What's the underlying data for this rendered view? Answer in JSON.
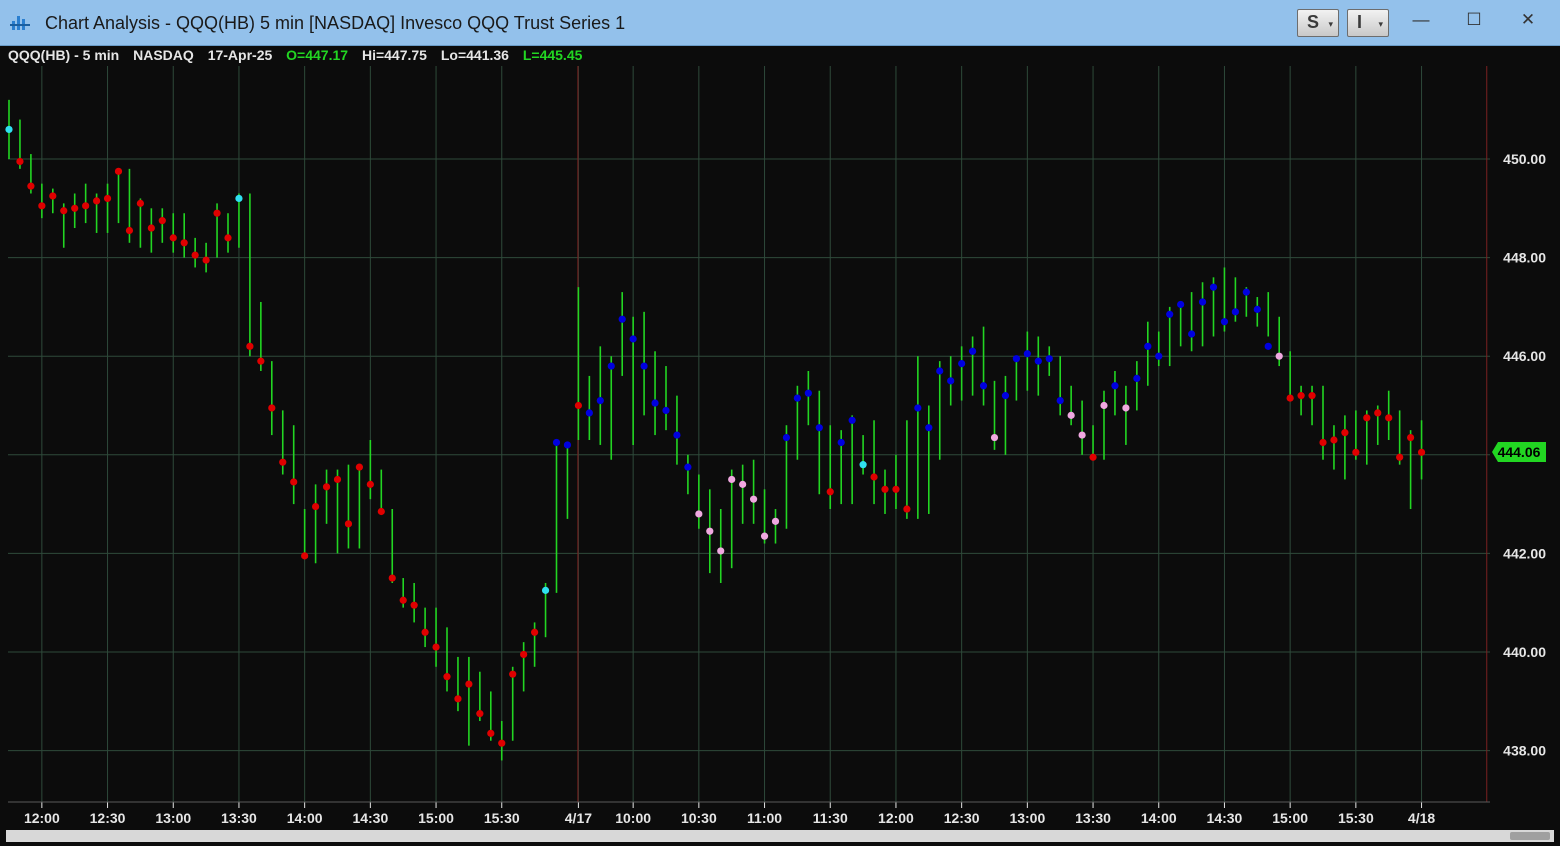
{
  "window": {
    "title": "Chart Analysis - QQQ(HB) 5 min [NASDAQ] Invesco QQQ Trust Series 1",
    "btn_s": "S",
    "btn_i": "I",
    "minimize": "—",
    "maximize": "☐",
    "close": "✕"
  },
  "header": {
    "symbol": "QQQ(HB) - 5 min",
    "exchange": "NASDAQ",
    "date": "17-Apr-25",
    "open": "O=447.17",
    "high": "Hi=447.75",
    "low": "Lo=441.36",
    "last": "L=445.45"
  },
  "last_price_label": "444.06",
  "colors": {
    "bar": "#22d622",
    "dot_red": "#e00000",
    "dot_blue": "#0000e0",
    "dot_pink": "#f0a8e0",
    "dot_cyan": "#30e0f0",
    "grid": "#2e4a3a",
    "session_line": "#7a2020",
    "text": "#e6e6e6",
    "last_price": "#22d622"
  },
  "chart_data": {
    "type": "ohlc-bar",
    "ylim": [
      437,
      452.3
    ],
    "y_ticks": [
      "450.00",
      "448.00",
      "446.00",
      "444.00",
      "442.00",
      "440.00",
      "438.00"
    ],
    "y_tick_values": [
      450,
      448,
      446,
      444,
      442,
      440,
      438
    ],
    "x_tick_labels": [
      "12:00",
      "12:30",
      "13:00",
      "13:30",
      "14:00",
      "14:30",
      "15:00",
      "15:30",
      "4/17",
      "10:00",
      "10:30",
      "11:00",
      "11:30",
      "12:00",
      "12:30",
      "13:00",
      "13:30",
      "14:00",
      "14:30",
      "15:00",
      "15:30",
      "4/18"
    ],
    "x_tick_bar_index": [
      3,
      9,
      15,
      21,
      27,
      33,
      39,
      45,
      52,
      57,
      63,
      69,
      75,
      81,
      87,
      93,
      99,
      105,
      111,
      117,
      123,
      129
    ],
    "session_break_bar_index": [
      52,
      135
    ],
    "dot_series_names": [
      "red",
      "blue",
      "pink",
      "cyan"
    ],
    "bars": [
      {
        "h": 451.2,
        "l": 450.0,
        "c": 450.6,
        "d": 3
      },
      {
        "h": 450.8,
        "l": 449.8,
        "c": 449.95,
        "d": 0
      },
      {
        "h": 450.1,
        "l": 449.3,
        "c": 449.45,
        "d": 0
      },
      {
        "h": 449.5,
        "l": 448.8,
        "c": 449.05,
        "d": 0
      },
      {
        "h": 449.4,
        "l": 448.9,
        "c": 449.25,
        "d": 0
      },
      {
        "h": 449.1,
        "l": 448.2,
        "c": 448.95,
        "d": 0
      },
      {
        "h": 449.3,
        "l": 448.6,
        "c": 449.0,
        "d": 0
      },
      {
        "h": 449.5,
        "l": 448.7,
        "c": 449.05,
        "d": 0
      },
      {
        "h": 449.3,
        "l": 448.5,
        "c": 449.15,
        "d": 0
      },
      {
        "h": 449.5,
        "l": 448.5,
        "c": 449.2,
        "d": 0
      },
      {
        "h": 449.8,
        "l": 448.7,
        "c": 449.75,
        "d": 0
      },
      {
        "h": 449.8,
        "l": 448.3,
        "c": 448.55,
        "d": 0
      },
      {
        "h": 449.2,
        "l": 448.2,
        "c": 449.1,
        "d": 0
      },
      {
        "h": 449.0,
        "l": 448.1,
        "c": 448.6,
        "d": 0
      },
      {
        "h": 449.0,
        "l": 448.3,
        "c": 448.75,
        "d": 0
      },
      {
        "h": 448.9,
        "l": 448.1,
        "c": 448.4,
        "d": 0
      },
      {
        "h": 448.9,
        "l": 448.0,
        "c": 448.3,
        "d": 0
      },
      {
        "h": 448.4,
        "l": 447.8,
        "c": 448.05,
        "d": 0
      },
      {
        "h": 448.3,
        "l": 447.7,
        "c": 447.95,
        "d": 0
      },
      {
        "h": 449.1,
        "l": 448.0,
        "c": 448.9,
        "d": 0
      },
      {
        "h": 448.9,
        "l": 448.1,
        "c": 448.4,
        "d": 0
      },
      {
        "h": 449.3,
        "l": 448.2,
        "c": 449.2,
        "d": 3
      },
      {
        "h": 449.3,
        "l": 446.0,
        "c": 446.2,
        "d": 0
      },
      {
        "h": 447.1,
        "l": 445.7,
        "c": 445.9,
        "d": 0
      },
      {
        "h": 445.9,
        "l": 444.4,
        "c": 444.95,
        "d": 0
      },
      {
        "h": 444.9,
        "l": 443.6,
        "c": 443.85,
        "d": 0
      },
      {
        "h": 444.6,
        "l": 443.0,
        "c": 443.45,
        "d": 0
      },
      {
        "h": 442.9,
        "l": 441.9,
        "c": 441.95,
        "d": 0
      },
      {
        "h": 443.4,
        "l": 441.8,
        "c": 442.95,
        "d": 0
      },
      {
        "h": 443.7,
        "l": 442.6,
        "c": 443.35,
        "d": 0
      },
      {
        "h": 443.7,
        "l": 442.0,
        "c": 443.5,
        "d": 0
      },
      {
        "h": 443.8,
        "l": 442.1,
        "c": 442.6,
        "d": 0
      },
      {
        "h": 443.8,
        "l": 442.1,
        "c": 443.75,
        "d": 0
      },
      {
        "h": 444.3,
        "l": 443.1,
        "c": 443.4,
        "d": 0
      },
      {
        "h": 443.7,
        "l": 442.8,
        "c": 442.85,
        "d": 0
      },
      {
        "h": 442.9,
        "l": 441.4,
        "c": 441.5,
        "d": 0
      },
      {
        "h": 441.5,
        "l": 440.9,
        "c": 441.05,
        "d": 0
      },
      {
        "h": 441.4,
        "l": 440.6,
        "c": 440.95,
        "d": 0
      },
      {
        "h": 440.9,
        "l": 440.1,
        "c": 440.4,
        "d": 0
      },
      {
        "h": 440.9,
        "l": 439.7,
        "c": 440.1,
        "d": 0
      },
      {
        "h": 440.5,
        "l": 439.2,
        "c": 439.5,
        "d": 0
      },
      {
        "h": 439.9,
        "l": 438.8,
        "c": 439.05,
        "d": 0
      },
      {
        "h": 439.9,
        "l": 438.1,
        "c": 439.35,
        "d": 0
      },
      {
        "h": 439.6,
        "l": 438.6,
        "c": 438.75,
        "d": 0
      },
      {
        "h": 439.2,
        "l": 438.2,
        "c": 438.35,
        "d": 0
      },
      {
        "h": 438.6,
        "l": 437.8,
        "c": 438.15,
        "d": 0
      },
      {
        "h": 439.7,
        "l": 438.2,
        "c": 439.55,
        "d": 0
      },
      {
        "h": 440.2,
        "l": 439.2,
        "c": 439.95,
        "d": 0
      },
      {
        "h": 440.6,
        "l": 439.7,
        "c": 440.4,
        "d": 0
      },
      {
        "h": 441.4,
        "l": 440.3,
        "c": 441.25,
        "d": 3
      },
      {
        "h": 444.3,
        "l": 441.2,
        "c": 444.25,
        "d": 1
      },
      {
        "h": 444.2,
        "l": 442.7,
        "c": 444.2,
        "d": 1
      },
      {
        "h": 447.4,
        "l": 444.3,
        "c": 445.0,
        "d": 0
      },
      {
        "h": 445.6,
        "l": 444.3,
        "c": 444.85,
        "d": 1
      },
      {
        "h": 446.2,
        "l": 444.2,
        "c": 445.1,
        "d": 1
      },
      {
        "h": 446.0,
        "l": 443.9,
        "c": 445.8,
        "d": 1
      },
      {
        "h": 447.3,
        "l": 445.6,
        "c": 446.75,
        "d": 1
      },
      {
        "h": 446.8,
        "l": 444.2,
        "c": 446.35,
        "d": 1
      },
      {
        "h": 446.9,
        "l": 444.8,
        "c": 445.8,
        "d": 1
      },
      {
        "h": 446.1,
        "l": 444.4,
        "c": 445.05,
        "d": 1
      },
      {
        "h": 445.8,
        "l": 444.5,
        "c": 444.9,
        "d": 1
      },
      {
        "h": 445.2,
        "l": 443.8,
        "c": 444.4,
        "d": 1
      },
      {
        "h": 444.0,
        "l": 443.2,
        "c": 443.75,
        "d": 1
      },
      {
        "h": 443.6,
        "l": 442.5,
        "c": 442.8,
        "d": 2
      },
      {
        "h": 443.3,
        "l": 441.6,
        "c": 442.45,
        "d": 2
      },
      {
        "h": 442.9,
        "l": 441.4,
        "c": 442.05,
        "d": 2
      },
      {
        "h": 443.7,
        "l": 441.7,
        "c": 443.5,
        "d": 2
      },
      {
        "h": 443.8,
        "l": 442.6,
        "c": 443.4,
        "d": 2
      },
      {
        "h": 443.9,
        "l": 442.6,
        "c": 443.1,
        "d": 2
      },
      {
        "h": 443.3,
        "l": 442.2,
        "c": 442.35,
        "d": 2
      },
      {
        "h": 442.9,
        "l": 442.2,
        "c": 442.65,
        "d": 2
      },
      {
        "h": 444.6,
        "l": 442.5,
        "c": 444.35,
        "d": 1
      },
      {
        "h": 445.4,
        "l": 443.9,
        "c": 445.15,
        "d": 1
      },
      {
        "h": 445.7,
        "l": 444.6,
        "c": 445.25,
        "d": 1
      },
      {
        "h": 445.3,
        "l": 443.2,
        "c": 444.55,
        "d": 1
      },
      {
        "h": 444.6,
        "l": 442.9,
        "c": 443.25,
        "d": 0
      },
      {
        "h": 444.5,
        "l": 443.0,
        "c": 444.25,
        "d": 1
      },
      {
        "h": 444.8,
        "l": 443.0,
        "c": 444.7,
        "d": 1
      },
      {
        "h": 444.4,
        "l": 443.6,
        "c": 443.8,
        "d": 3
      },
      {
        "h": 444.7,
        "l": 443.0,
        "c": 443.55,
        "d": 0
      },
      {
        "h": 443.7,
        "l": 442.8,
        "c": 443.3,
        "d": 0
      },
      {
        "h": 444.0,
        "l": 442.9,
        "c": 443.3,
        "d": 0
      },
      {
        "h": 444.7,
        "l": 442.7,
        "c": 442.9,
        "d": 0
      },
      {
        "h": 446.0,
        "l": 442.7,
        "c": 444.95,
        "d": 1
      },
      {
        "h": 445.0,
        "l": 442.8,
        "c": 444.55,
        "d": 1
      },
      {
        "h": 445.9,
        "l": 443.9,
        "c": 445.7,
        "d": 1
      },
      {
        "h": 446.0,
        "l": 445.0,
        "c": 445.5,
        "d": 1
      },
      {
        "h": 446.2,
        "l": 445.1,
        "c": 445.85,
        "d": 1
      },
      {
        "h": 446.4,
        "l": 445.2,
        "c": 446.1,
        "d": 1
      },
      {
        "h": 446.6,
        "l": 445.0,
        "c": 445.4,
        "d": 1
      },
      {
        "h": 445.5,
        "l": 444.1,
        "c": 444.35,
        "d": 2
      },
      {
        "h": 445.6,
        "l": 444.0,
        "c": 445.2,
        "d": 1
      },
      {
        "h": 446.0,
        "l": 445.1,
        "c": 445.95,
        "d": 1
      },
      {
        "h": 446.5,
        "l": 445.3,
        "c": 446.05,
        "d": 1
      },
      {
        "h": 446.4,
        "l": 445.2,
        "c": 445.9,
        "d": 1
      },
      {
        "h": 446.2,
        "l": 445.6,
        "c": 445.95,
        "d": 1
      },
      {
        "h": 446.0,
        "l": 444.8,
        "c": 445.1,
        "d": 1
      },
      {
        "h": 445.4,
        "l": 444.6,
        "c": 444.8,
        "d": 2
      },
      {
        "h": 445.1,
        "l": 444.0,
        "c": 444.4,
        "d": 2
      },
      {
        "h": 444.6,
        "l": 443.9,
        "c": 443.95,
        "d": 0
      },
      {
        "h": 445.3,
        "l": 443.9,
        "c": 445.0,
        "d": 2
      },
      {
        "h": 445.7,
        "l": 444.8,
        "c": 445.4,
        "d": 1
      },
      {
        "h": 445.4,
        "l": 444.2,
        "c": 444.95,
        "d": 2
      },
      {
        "h": 445.9,
        "l": 444.9,
        "c": 445.55,
        "d": 1
      },
      {
        "h": 446.7,
        "l": 445.4,
        "c": 446.2,
        "d": 1
      },
      {
        "h": 446.5,
        "l": 445.8,
        "c": 446.0,
        "d": 1
      },
      {
        "h": 447.0,
        "l": 445.8,
        "c": 446.85,
        "d": 1
      },
      {
        "h": 447.1,
        "l": 446.2,
        "c": 447.05,
        "d": 1
      },
      {
        "h": 447.3,
        "l": 446.1,
        "c": 446.45,
        "d": 1
      },
      {
        "h": 447.5,
        "l": 446.2,
        "c": 447.1,
        "d": 1
      },
      {
        "h": 447.6,
        "l": 446.4,
        "c": 447.4,
        "d": 1
      },
      {
        "h": 447.8,
        "l": 446.5,
        "c": 446.7,
        "d": 1
      },
      {
        "h": 447.6,
        "l": 446.7,
        "c": 446.9,
        "d": 1
      },
      {
        "h": 447.4,
        "l": 446.8,
        "c": 447.3,
        "d": 1
      },
      {
        "h": 447.2,
        "l": 446.6,
        "c": 446.95,
        "d": 1
      },
      {
        "h": 447.3,
        "l": 446.4,
        "c": 446.2,
        "d": 1
      },
      {
        "h": 446.8,
        "l": 445.8,
        "c": 446.0,
        "d": 2
      },
      {
        "h": 446.1,
        "l": 445.1,
        "c": 445.15,
        "d": 0
      },
      {
        "h": 445.4,
        "l": 444.8,
        "c": 445.2,
        "d": 0
      },
      {
        "h": 445.4,
        "l": 444.6,
        "c": 445.2,
        "d": 0
      },
      {
        "h": 445.4,
        "l": 443.9,
        "c": 444.25,
        "d": 0
      },
      {
        "h": 444.6,
        "l": 443.7,
        "c": 444.3,
        "d": 0
      },
      {
        "h": 444.8,
        "l": 443.5,
        "c": 444.45,
        "d": 0
      },
      {
        "h": 444.9,
        "l": 443.9,
        "c": 444.05,
        "d": 0
      },
      {
        "h": 444.9,
        "l": 443.8,
        "c": 444.75,
        "d": 0
      },
      {
        "h": 445.0,
        "l": 444.2,
        "c": 444.85,
        "d": 0
      },
      {
        "h": 445.3,
        "l": 444.3,
        "c": 444.75,
        "d": 0
      },
      {
        "h": 444.9,
        "l": 443.8,
        "c": 443.95,
        "d": 0
      },
      {
        "h": 444.5,
        "l": 442.9,
        "c": 444.35,
        "d": 0
      },
      {
        "h": 444.7,
        "l": 443.5,
        "c": 444.05,
        "d": 0
      }
    ]
  }
}
